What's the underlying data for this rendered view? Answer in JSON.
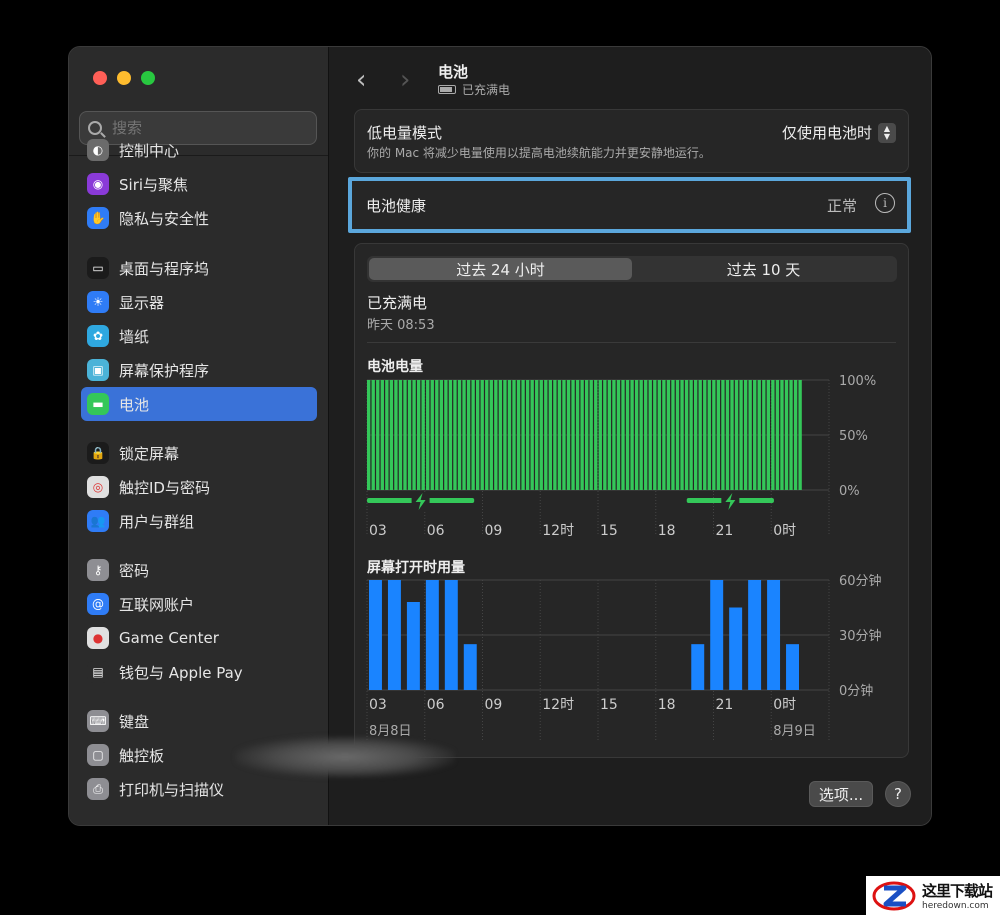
{
  "sidebar": {
    "search_placeholder": "搜索",
    "items": [
      {
        "label": "控制中心",
        "icon": "control-center-icon",
        "color": "#6b6b6b",
        "top": 0
      },
      {
        "label": "Siri与聚焦",
        "icon": "siri-icon",
        "color": "#8a3ad8"
      },
      {
        "label": "隐私与安全性",
        "icon": "privacy-hand-icon",
        "color": "#2f7cf6"
      },
      {
        "label": "桌面与程序坞",
        "icon": "dock-icon",
        "color": "#1b1b1b"
      },
      {
        "label": "显示器",
        "icon": "display-icon",
        "color": "#2f7cf6"
      },
      {
        "label": "墙纸",
        "icon": "wallpaper-icon",
        "color": "#2fa8e0"
      },
      {
        "label": "屏幕保护程序",
        "icon": "screensaver-icon",
        "color": "#4bb3d8"
      },
      {
        "label": "电池",
        "icon": "battery-icon",
        "color": "#34c759",
        "active": true
      },
      {
        "label": "锁定屏幕",
        "icon": "lock-icon",
        "color": "#1b1b1b"
      },
      {
        "label": "触控ID与密码",
        "icon": "fingerprint-icon",
        "color": "#e0e0e0"
      },
      {
        "label": "用户与群组",
        "icon": "users-icon",
        "color": "#2f7cf6"
      },
      {
        "label": "密码",
        "icon": "key-icon",
        "color": "#8e8e93"
      },
      {
        "label": "互联网账户",
        "icon": "at-icon",
        "color": "#2f7cf6"
      },
      {
        "label": "Game Center",
        "icon": "game-center-icon",
        "color": "#e0e0e0"
      },
      {
        "label": "钱包与 Apple Pay",
        "icon": "wallet-icon",
        "color": "#2b2b2b"
      },
      {
        "label": "键盘",
        "icon": "keyboard-icon",
        "color": "#8e8e93"
      },
      {
        "label": "触控板",
        "icon": "trackpad-icon",
        "color": "#8e8e93"
      },
      {
        "label": "打印机与扫描仪",
        "icon": "printer-icon",
        "color": "#8e8e93"
      }
    ]
  },
  "header": {
    "title": "电池",
    "subtitle": "已充满电"
  },
  "low_power": {
    "title": "低电量模式",
    "description": "你的 Mac 将减少电量使用以提高电池续航能力并更安静地运行。",
    "value": "仅使用电池时"
  },
  "battery_health": {
    "title": "电池健康",
    "status": "正常"
  },
  "tabs": [
    "过去 24 小时",
    "过去 10 天"
  ],
  "status": {
    "title": "已充满电",
    "time": "昨天 08:53"
  },
  "battery_chart_title": "电池电量",
  "screen_chart_title": "屏幕打开时用量",
  "buttons": {
    "options": "选项...",
    "help": "?"
  },
  "colors": {
    "accent": "#3a72d8",
    "battery_green": "#34c759",
    "screen_blue": "#1a84ff",
    "highlight": "#5ba7dc"
  },
  "watermark": {
    "cn": "这里下载站",
    "en": "heredown.com"
  },
  "chart_data": [
    {
      "type": "bar",
      "title": "电池电量",
      "x_tick_labels": [
        "03",
        "06",
        "09",
        "12时",
        "15",
        "18",
        "21",
        "0时"
      ],
      "y_tick_labels": [
        "100%",
        "50%",
        "0%"
      ],
      "ylim": [
        0,
        100
      ],
      "values": [
        100,
        100,
        100,
        100,
        100,
        100,
        100,
        100,
        100,
        100,
        100,
        100,
        100,
        100,
        100,
        100,
        100,
        100,
        100,
        100,
        100,
        100,
        100,
        100,
        100,
        100,
        100,
        100,
        100,
        100,
        100,
        100,
        100,
        100,
        100,
        100,
        100,
        100,
        100,
        100,
        100,
        100,
        100,
        100,
        100,
        100,
        100,
        100,
        100,
        100,
        100,
        100,
        100,
        100,
        100,
        100,
        100,
        100,
        100,
        100,
        100,
        100,
        100,
        100,
        100,
        100,
        100,
        100,
        100,
        100,
        100,
        100,
        100,
        100,
        100,
        100,
        100,
        100,
        100,
        100,
        100,
        100,
        100,
        100,
        100,
        100,
        100,
        100,
        100,
        100,
        100,
        100,
        100,
        100,
        100,
        100
      ],
      "charging_ranges": [
        [
          0,
          5.9
        ],
        [
          17.6,
          22.4
        ]
      ]
    },
    {
      "type": "bar",
      "title": "屏幕打开时用量",
      "x_tick_labels": [
        "03",
        "06",
        "09",
        "12时",
        "15",
        "18",
        "21",
        "0时"
      ],
      "y_tick_labels": [
        "60分钟",
        "30分钟",
        "0分钟"
      ],
      "ylim": [
        0,
        60
      ],
      "values": [
        60,
        60,
        48,
        60,
        60,
        25,
        0,
        0,
        0,
        0,
        0,
        0,
        0,
        0,
        0,
        0,
        0,
        25,
        60,
        45,
        60,
        60,
        25
      ],
      "date_labels": [
        "8月8日",
        "8月9日"
      ]
    }
  ]
}
